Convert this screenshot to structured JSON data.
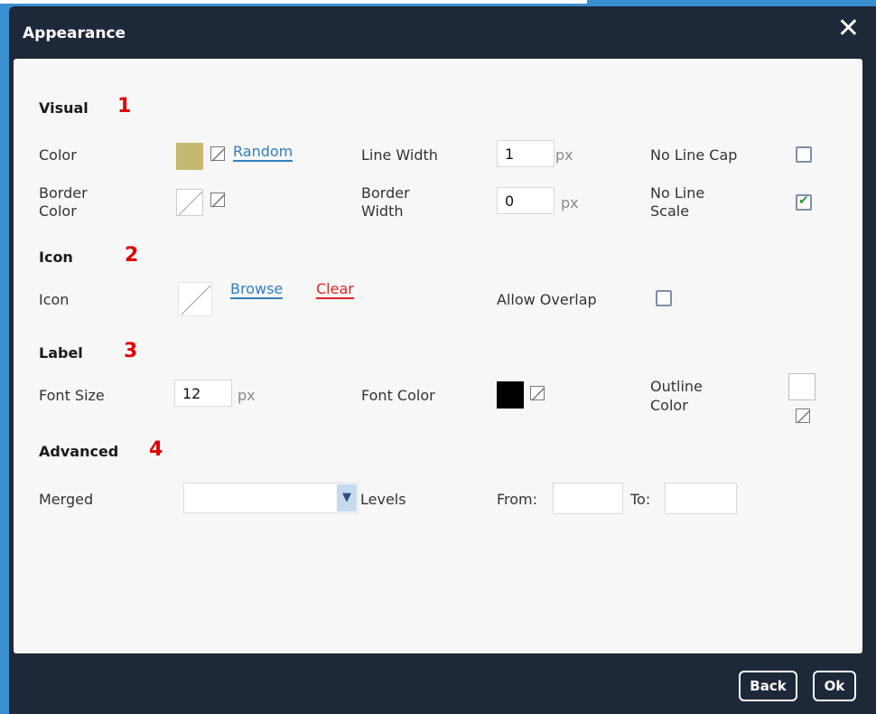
{
  "dialog": {
    "title": "Appearance",
    "close_icon": "close-icon"
  },
  "visual": {
    "title": "Visual",
    "number": "1",
    "color_label": "Color",
    "color_value": "#c6b870",
    "random_link": "Random",
    "line_width_label": "Line Width",
    "line_width_value": "1",
    "line_width_unit": "px",
    "no_line_cap_label": "No Line Cap",
    "no_line_cap_checked": false,
    "border_color_label_1": "Border",
    "border_color_label_2": "Color",
    "border_width_label_1": "Border",
    "border_width_label_2": "Width",
    "border_width_value": "0",
    "border_width_unit": "px",
    "no_line_scale_label_1": "No Line",
    "no_line_scale_label_2": "Scale",
    "no_line_scale_checked": true
  },
  "icon": {
    "title": "Icon",
    "number": "2",
    "icon_label": "Icon",
    "browse_link": "Browse",
    "clear_link": "Clear",
    "allow_overlap_label": "Allow Overlap",
    "allow_overlap_checked": false
  },
  "label": {
    "title": "Label",
    "number": "3",
    "font_size_label": "Font Size",
    "font_size_value": "12",
    "font_size_unit": "px",
    "font_color_label": "Font Color",
    "font_color_value": "#000000",
    "outline_color_label_1": "Outline",
    "outline_color_label_2": "Color"
  },
  "advanced": {
    "title": "Advanced",
    "number": "4",
    "merged_label": "Merged",
    "merged_value": "",
    "levels_label": "Levels",
    "from_label": "From:",
    "from_value": "",
    "to_label": "To:",
    "to_value": ""
  },
  "footer": {
    "back_label": "Back",
    "ok_label": "Ok"
  }
}
